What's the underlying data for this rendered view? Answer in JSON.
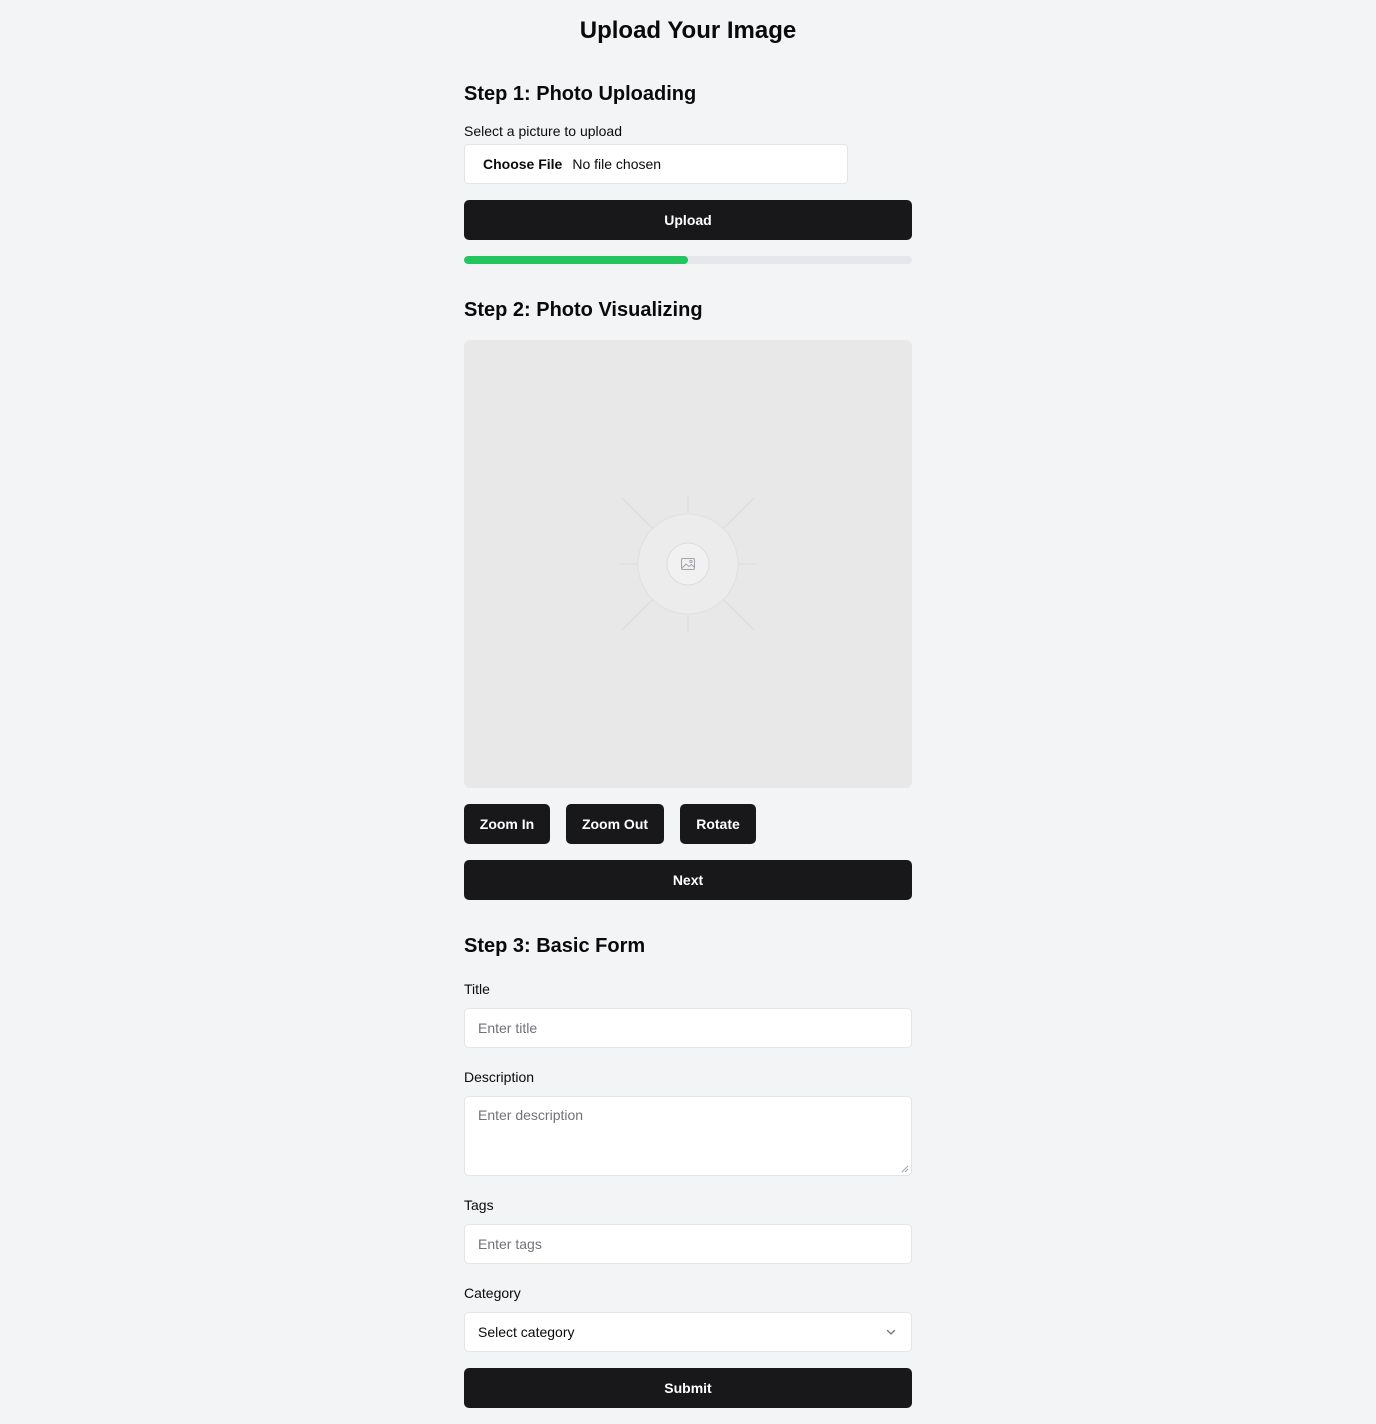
{
  "page": {
    "title": "Upload Your Image"
  },
  "step1": {
    "heading": "Step 1: Photo Uploading",
    "file_label": "Select a picture to upload",
    "choose_file_label": "Choose File",
    "file_status": "No file chosen",
    "upload_label": "Upload",
    "progress_fraction": 0.5,
    "progress_color": "#22c55e"
  },
  "step2": {
    "heading": "Step 2: Photo Visualizing",
    "placeholder_icon": "image-icon",
    "zoom_in_label": "Zoom In",
    "zoom_out_label": "Zoom Out",
    "rotate_label": "Rotate",
    "next_label": "Next"
  },
  "step3": {
    "heading": "Step 3: Basic Form",
    "title_label": "Title",
    "title_placeholder": "Enter title",
    "description_label": "Description",
    "description_placeholder": "Enter description",
    "tags_label": "Tags",
    "tags_placeholder": "Enter tags",
    "category_label": "Category",
    "category_selected": "Select category",
    "submit_label": "Submit"
  },
  "colors": {
    "background": "#f3f4f6",
    "button": "#18181b",
    "accent": "#22c55e"
  }
}
